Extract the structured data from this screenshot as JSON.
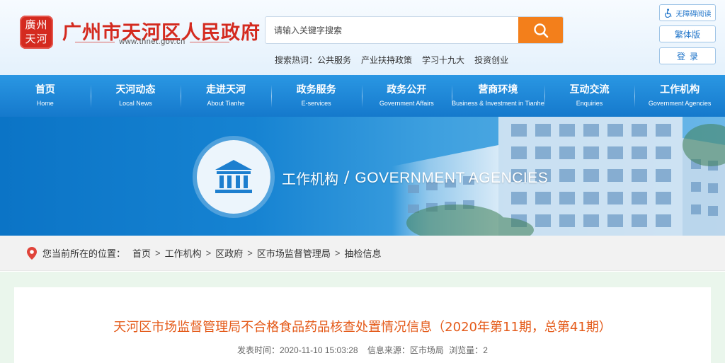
{
  "header": {
    "logo_lines": [
      "廣州",
      "天河"
    ],
    "site_title": "广州市天河区人民政府",
    "site_url": "www.thnet.gov.cn",
    "search_placeholder": "请输入关键字搜索",
    "hot_label": "搜索热词：",
    "hot_words": [
      "公共服务",
      "产业扶持政策",
      "学习十九大",
      "投资创业"
    ],
    "accessibility_label": "无障碍阅读",
    "traditional_label": "繁体版",
    "login_label": "登录"
  },
  "nav": [
    {
      "cn": "首页",
      "en": "Home"
    },
    {
      "cn": "天河动态",
      "en": "Local News"
    },
    {
      "cn": "走进天河",
      "en": "About Tianhe"
    },
    {
      "cn": "政务服务",
      "en": "E-services"
    },
    {
      "cn": "政务公开",
      "en": "Government Affairs"
    },
    {
      "cn": "营商环境",
      "en": "Business & Investment in Tianhe"
    },
    {
      "cn": "互动交流",
      "en": "Enquiries"
    },
    {
      "cn": "工作机构",
      "en": "Government Agencies"
    }
  ],
  "banner": {
    "title_cn": "工作机构",
    "slash": "/",
    "title_en": "GOVERNMENT AGENCIES"
  },
  "breadcrumb": {
    "lead": "您当前所在的位置：",
    "items": [
      "首页",
      "工作机构",
      "区政府",
      "区市场监督管理局",
      "抽检信息"
    ],
    "separator": ">"
  },
  "article": {
    "title": "天河区市场监督管理局不合格食品药品核查处置情况信息（2020年第11期，总第41期）",
    "publish_time": "发表时间：2020-11-10 15:03:28",
    "source": "信息来源：区市场局",
    "views": "浏览量：2"
  },
  "colors": {
    "brand_red": "#d42a1f",
    "nav_blue": "#1a86d6",
    "search_orange": "#f37f1b",
    "title_orange": "#e45a19"
  },
  "icons": [
    "search-icon",
    "accessibility-icon",
    "government-building-icon",
    "location-pin-icon"
  ]
}
